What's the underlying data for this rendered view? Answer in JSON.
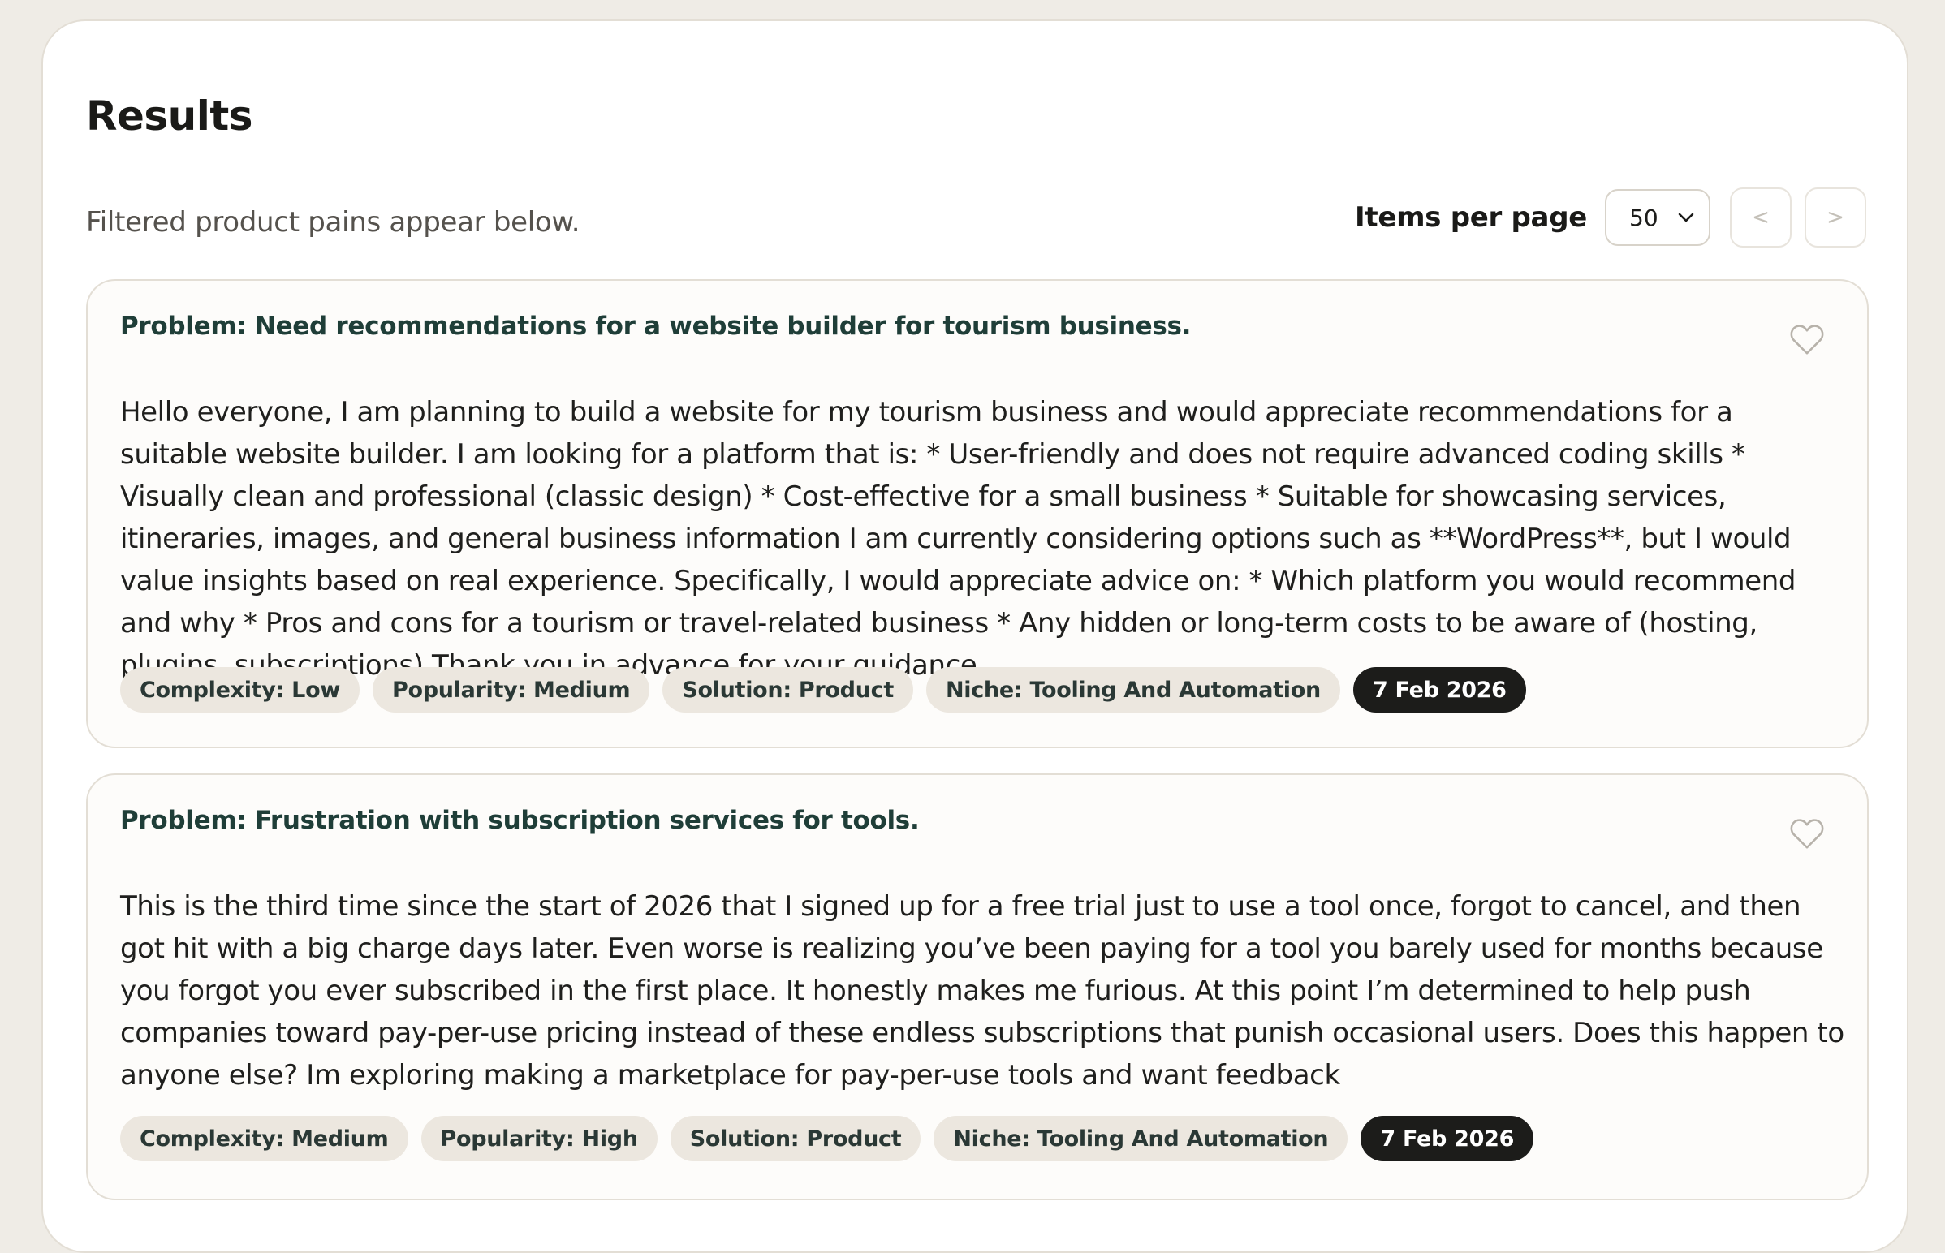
{
  "header": {
    "title": "Results",
    "subtitle": "Filtered product pains appear below."
  },
  "pagination": {
    "items_per_page_label": "Items per page",
    "items_per_page_value": "50",
    "prev_label": "<",
    "next_label": ">"
  },
  "icons": {
    "favorite": "heart-outline-icon",
    "select_arrow": "chevron-down-icon"
  },
  "colors": {
    "page_background": "#efece6",
    "panel_background": "#ffffff",
    "card_background": "#fdfcfa",
    "card_title": "#1f3e38",
    "tag_background": "#ece7df",
    "date_tag_background": "#1c1c1a"
  },
  "results": [
    {
      "title": "Problem: Need recommendations for a website builder for tourism business.",
      "body": "Hello everyone, I am planning to build a website for my tourism business and would appreciate recommendations for a suitable website builder. I am looking for a platform that is: * User-friendly and does not require advanced coding skills * Visually clean and professional (classic design) * Cost-effective for a small business * Suitable for showcasing services, itineraries, images, and general business information I am currently considering options such as **WordPress**, but I would value insights based on real experience. Specifically, I would appreciate advice on: * Which platform you would recommend and why * Pros and cons for a tourism or travel-related business * Any hidden or long-term costs to be aware of (hosting, plugins, subscriptions) Thank you in advance for your guidance.",
      "complexity": "Complexity: Low",
      "popularity": "Popularity: Medium",
      "solution": "Solution: Product",
      "niche": "Niche: Tooling And Automation",
      "date": "7 Feb 2026"
    },
    {
      "title": "Problem: Frustration with subscription services for tools.",
      "body": "This is the third time since the start of 2026 that I signed up for a free trial just to use a tool once, forgot to cancel, and then got hit with a big charge days later. Even worse is realizing you’ve been paying for a tool you barely used for months because you forgot you ever subscribed in the first place. It honestly makes me furious. At this point I’m determined to help push companies toward pay-per-use pricing instead of these endless subscriptions that punish occasional users. Does this happen to anyone else? Im exploring making a marketplace for pay-per-use tools and want feedback",
      "complexity": "Complexity: Medium",
      "popularity": "Popularity: High",
      "solution": "Solution: Product",
      "niche": "Niche: Tooling And Automation",
      "date": "7 Feb 2026"
    }
  ]
}
